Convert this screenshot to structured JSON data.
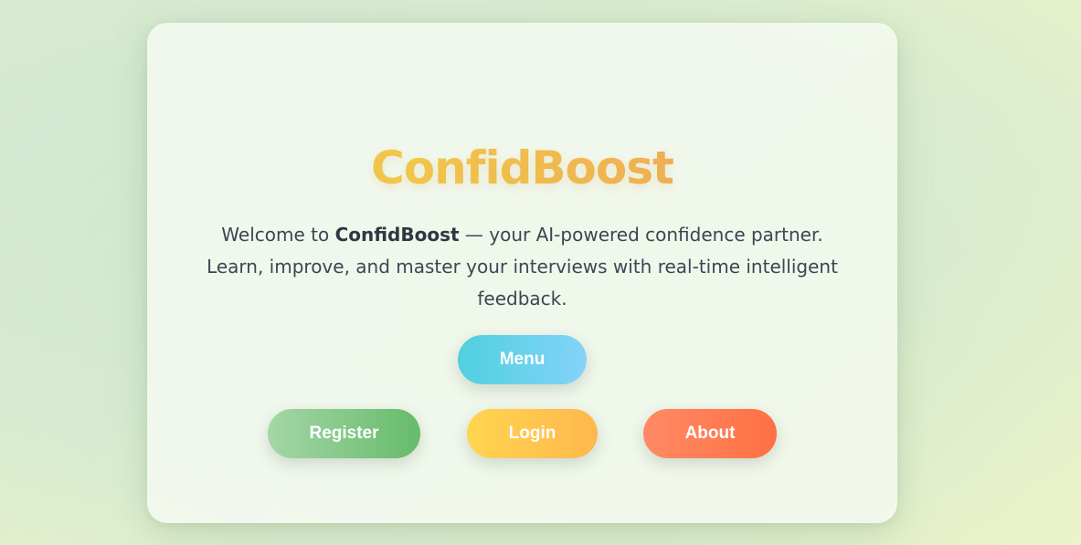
{
  "app": {
    "title": "ConfidBoost"
  },
  "intro": {
    "prefix": "Welcome to ",
    "brand": "ConfidBoost",
    "suffix": " — your AI-powered confidence partner. Learn, improve, and master your interviews with real-time intelligent feedback."
  },
  "buttons": {
    "menu": "Menu",
    "register": "Register",
    "login": "Login",
    "about": "About"
  },
  "colors": {
    "title_gradient": [
      "#e9c04a",
      "#f19b58"
    ],
    "menu_gradient": [
      "#4fd0df",
      "#84d3f8"
    ],
    "register_gradient": [
      "#a5d6a7",
      "#66bb6a"
    ],
    "login_gradient": [
      "#ffd54f",
      "#ffb74d"
    ],
    "about_gradient": [
      "#ff8a65",
      "#ff7043"
    ],
    "text": "#3d4652"
  }
}
